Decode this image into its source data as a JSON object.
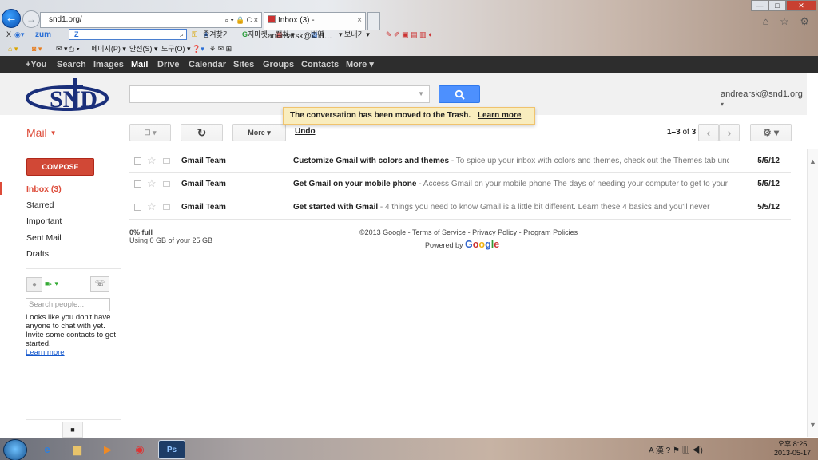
{
  "browser": {
    "back_glyph": "←",
    "forward_glyph": "→",
    "address": "snd1.org/",
    "address_controls": "⌕ ▾ 🔒 C ×",
    "tab_title": "Inbox (3) - andrearsk@snd…",
    "tab_close": "×",
    "window_controls": [
      "—",
      "□",
      "✕"
    ],
    "right_icons": "⌂ ☆ ⚙",
    "zum_toolbar": {
      "x_label": "X",
      "zum_logo": "zum",
      "search_logo": "Z",
      "items": [
        "즐겨찾기",
        "지마켓",
        "캡쳐 ▾",
        "번역",
        "▾ 보내기 ▾"
      ]
    },
    "command_bar": [
      "페이지(P) ▾",
      "안전(S) ▾",
      "도구(O) ▾"
    ]
  },
  "google_bar": {
    "items": [
      "+You",
      "Search",
      "Images",
      "Mail",
      "Drive",
      "Calendar",
      "Sites",
      "Groups",
      "Contacts",
      "More ▾"
    ],
    "active": "Mail"
  },
  "header": {
    "logo_alt": "SND",
    "account": "andrearsk@snd1.org",
    "account_caret": "▾"
  },
  "notification": {
    "text": "The conversation has been moved to the Trash.",
    "learn_more": "Learn more",
    "undo": "Undo"
  },
  "toolbar": {
    "mail_label": "Mail",
    "select_label": "☐ ▾",
    "refresh_label": "↻",
    "more_label": "More ▾",
    "count": "1–3",
    "count_of": "of",
    "count_total": "3",
    "prev_label": "‹",
    "next_label": "›",
    "settings_label": "⚙ ▾"
  },
  "sidebar": {
    "compose": "COMPOSE",
    "items": [
      "Inbox (3)",
      "Starred",
      "Important",
      "Sent Mail",
      "Drafts"
    ],
    "active_index": 0
  },
  "chat": {
    "video_label": "■▸ ▾",
    "phone_label": "☏",
    "search_placeholder": "Search people...",
    "empty_text": "Looks like you don't have anyone to chat with yet. Invite some contacts to get started.",
    "learn_more": "Learn more"
  },
  "messages": [
    {
      "from": "Gmail Team",
      "subject": "Customize Gmail with colors and themes",
      "snippet": " - To spice up your inbox with colors and themes, check out the Themes tab under Sett",
      "date": "5/5/12"
    },
    {
      "from": "Gmail Team",
      "subject": "Get Gmail on your mobile phone",
      "snippet": " - Access Gmail on your mobile phone The days of needing your computer to get to your inbox a",
      "date": "5/5/12"
    },
    {
      "from": "Gmail Team",
      "subject": "Get started with Gmail",
      "snippet": " - 4 things you need to know Gmail is a little bit different. Learn these 4 basics and you'll never",
      "date": "5/5/12"
    }
  ],
  "footer": {
    "storage_pct": "0% full",
    "storage_detail": "Using 0 GB of your 25 GB",
    "copyright": "©2013 Google -",
    "terms": "Terms of Service",
    "privacy": "Privacy Policy",
    "policies": "Program Policies",
    "powered_by": "Powered by",
    "google_word": "Google"
  },
  "taskbar": {
    "photoshop": "Ps",
    "tray": "A 漢 ?",
    "time": "오후 8:25",
    "date": "2013-05-17"
  },
  "colors": {
    "accent_red": "#dd4b39",
    "compose_red": "#d14836",
    "search_blue": "#4d90fe",
    "toast_bg": "#f9edbe",
    "gbar_bg": "#2d2d2d"
  }
}
